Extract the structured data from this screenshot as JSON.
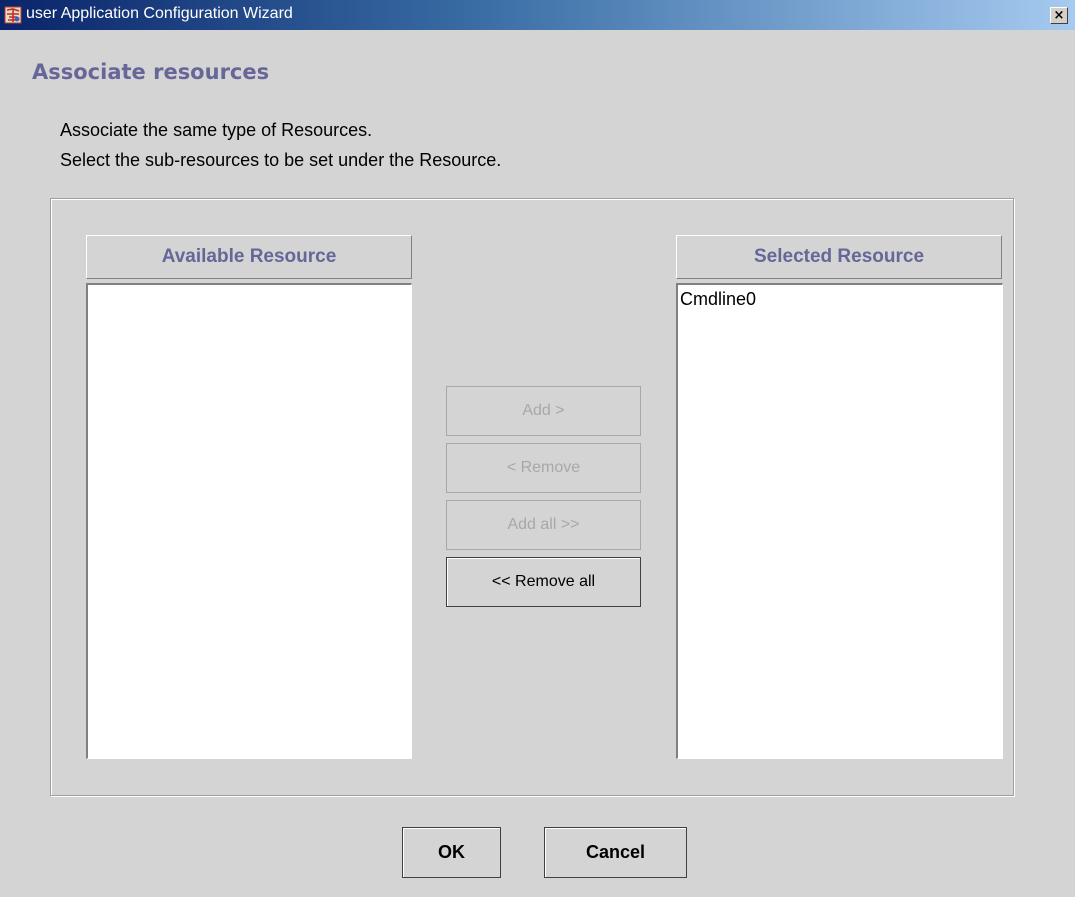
{
  "window": {
    "title": "user Application Configuration Wizard",
    "close_glyph": "×",
    "icon": "app-wizard-icon"
  },
  "heading": "Associate resources",
  "instructions": {
    "line1": "Associate the same type of Resources.",
    "line2": "Select the sub-resources to be set under the Resource."
  },
  "available": {
    "header": "Available Resource",
    "items": []
  },
  "selected": {
    "header": "Selected Resource",
    "items": [
      "Cmdline0"
    ]
  },
  "buttons": {
    "add": "Add >",
    "remove": "< Remove",
    "add_all": "Add all >>",
    "remove_all": "<< Remove all",
    "ok": "OK",
    "cancel": "Cancel"
  },
  "colors": {
    "accent_heading": "#666699",
    "titlebar_start": "#0a246a",
    "titlebar_end": "#a6caf0",
    "background": "#d4d4d4"
  }
}
